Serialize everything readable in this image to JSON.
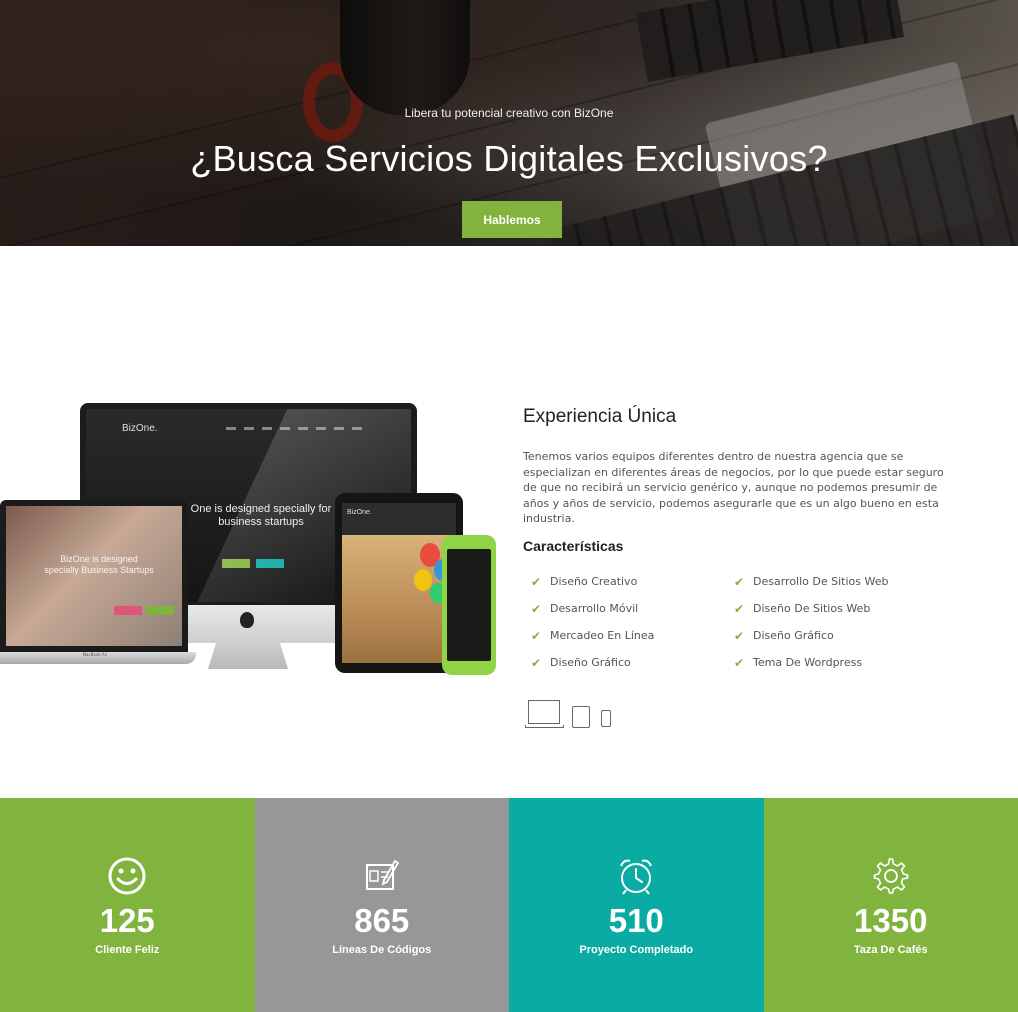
{
  "hero": {
    "subtitle": "Libera tu potencial creativo con BizOne",
    "title": "¿Busca Servicios Digitales Exclusivos?",
    "button_label": "Hablemos"
  },
  "devices": {
    "imac_logo": "BizOne.",
    "imac_tagline": "One is designed specially for business startups",
    "macbook_text": "BizOne is designed specially Business Startups",
    "macbook_label": "MacBook Air",
    "ipad_logo": "BizOne."
  },
  "about": {
    "title": "Experiencia Única",
    "text": "Tenemos varios equipos diferentes dentro de nuestra agencia que se especializan en diferentes áreas de negocios, por lo que puede estar seguro de que no recibirá un servicio genérico y, aunque no podemos presumir de años y años de servicio, podemos asegurarle que es un algo bueno en esta industria.",
    "features_title": "Características",
    "features_left": [
      "Diseño Creativo",
      "Desarrollo Móvil",
      "Mercadeo En Línea",
      "Diseño Gráfico"
    ],
    "features_right": [
      "Desarrollo De Sitios Web",
      "Diseño De Sitios Web",
      "Diseño Gráfico",
      "Tema De Wordpress"
    ],
    "check_icon": "check-icon"
  },
  "stats": [
    {
      "icon": "smiley-icon",
      "value": "125",
      "label": "Cliente Feliz",
      "color": "#80b43f"
    },
    {
      "icon": "edit-icon",
      "value": "865",
      "label": "Líneas De Códigos",
      "color": "#979797"
    },
    {
      "icon": "alarm-clock-icon",
      "value": "510",
      "label": "Proyecto Completado",
      "color": "#0aaba2"
    },
    {
      "icon": "gear-icon",
      "value": "1350",
      "label": "Taza De Cafés",
      "color": "#80b43f"
    }
  ],
  "colors": {
    "accent_green": "#81b33d",
    "gray": "#979797",
    "teal": "#0aaba2"
  }
}
